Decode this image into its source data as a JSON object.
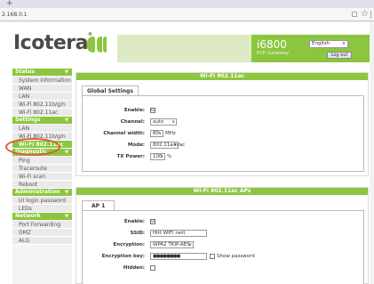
{
  "browser": {
    "new_tab_glyph": "+",
    "url": "2.168.0.1",
    "bookmark_glyph": "☆"
  },
  "header": {
    "logo_text": "Icotera",
    "logo_mark": "®",
    "model": "i6800",
    "subtitle": "P2P Gateway",
    "language": "English",
    "logout_label": "Log out"
  },
  "sidebar": {
    "sections": [
      {
        "title": "Status",
        "items": [
          "System information",
          "WAN",
          "LAN",
          "Wi-Fi 802.11b/g/n",
          "Wi-Fi 802.11ac"
        ]
      },
      {
        "title": "Settings",
        "items": [
          "LAN",
          "Wi-Fi 802.11b/g/n",
          "Wi-Fi 802.11ac"
        ]
      },
      {
        "title": "Diagnostic",
        "items": [
          "Ping",
          "Traceroute",
          "Wi-Fi scan",
          "Reboot"
        ]
      },
      {
        "title": "Administration",
        "items": [
          "UI login password",
          "LEDs"
        ]
      },
      {
        "title": "Network",
        "items": [
          "Port Forwarding",
          "DMZ",
          "ALG"
        ]
      }
    ],
    "caret": "▼",
    "active_item": "Wi-Fi 802.11ac"
  },
  "panel1": {
    "title": "Wi-Fi 802.11ac",
    "tab": "Global Settings",
    "fields": {
      "enable_label": "Enable:",
      "enable_checked": "☑",
      "channel_label": "Channel:",
      "channel_value": "auto",
      "width_label": "Channel width:",
      "width_value": "80",
      "width_unit": "MHz",
      "mode_label": "Mode:",
      "mode_value": "802.11a/n/ac",
      "power_label": "TX Power:",
      "power_value": "100",
      "power_unit": "%"
    }
  },
  "panel2": {
    "title": "Wi-Fi 802.11ac APs",
    "tab": "AP 1",
    "fields": {
      "enable_label": "Enable:",
      "enable_checked": "☑",
      "ssid_label": "SSID:",
      "ssid_value": "Hitt WIFI nett",
      "encryption_label": "Encryption:",
      "encryption_value": "WPA2 TKIP-AES",
      "key_label": "Encryption key:",
      "key_value": "●●●●●●●●",
      "show_password_label": "Show password",
      "hidden_label": "Hidden:"
    }
  },
  "select_arrow": "∨",
  "colors": {
    "brand_green": "#8cc63f",
    "light_green": "#dcebc3",
    "annotation_red": "#e35a3a"
  }
}
